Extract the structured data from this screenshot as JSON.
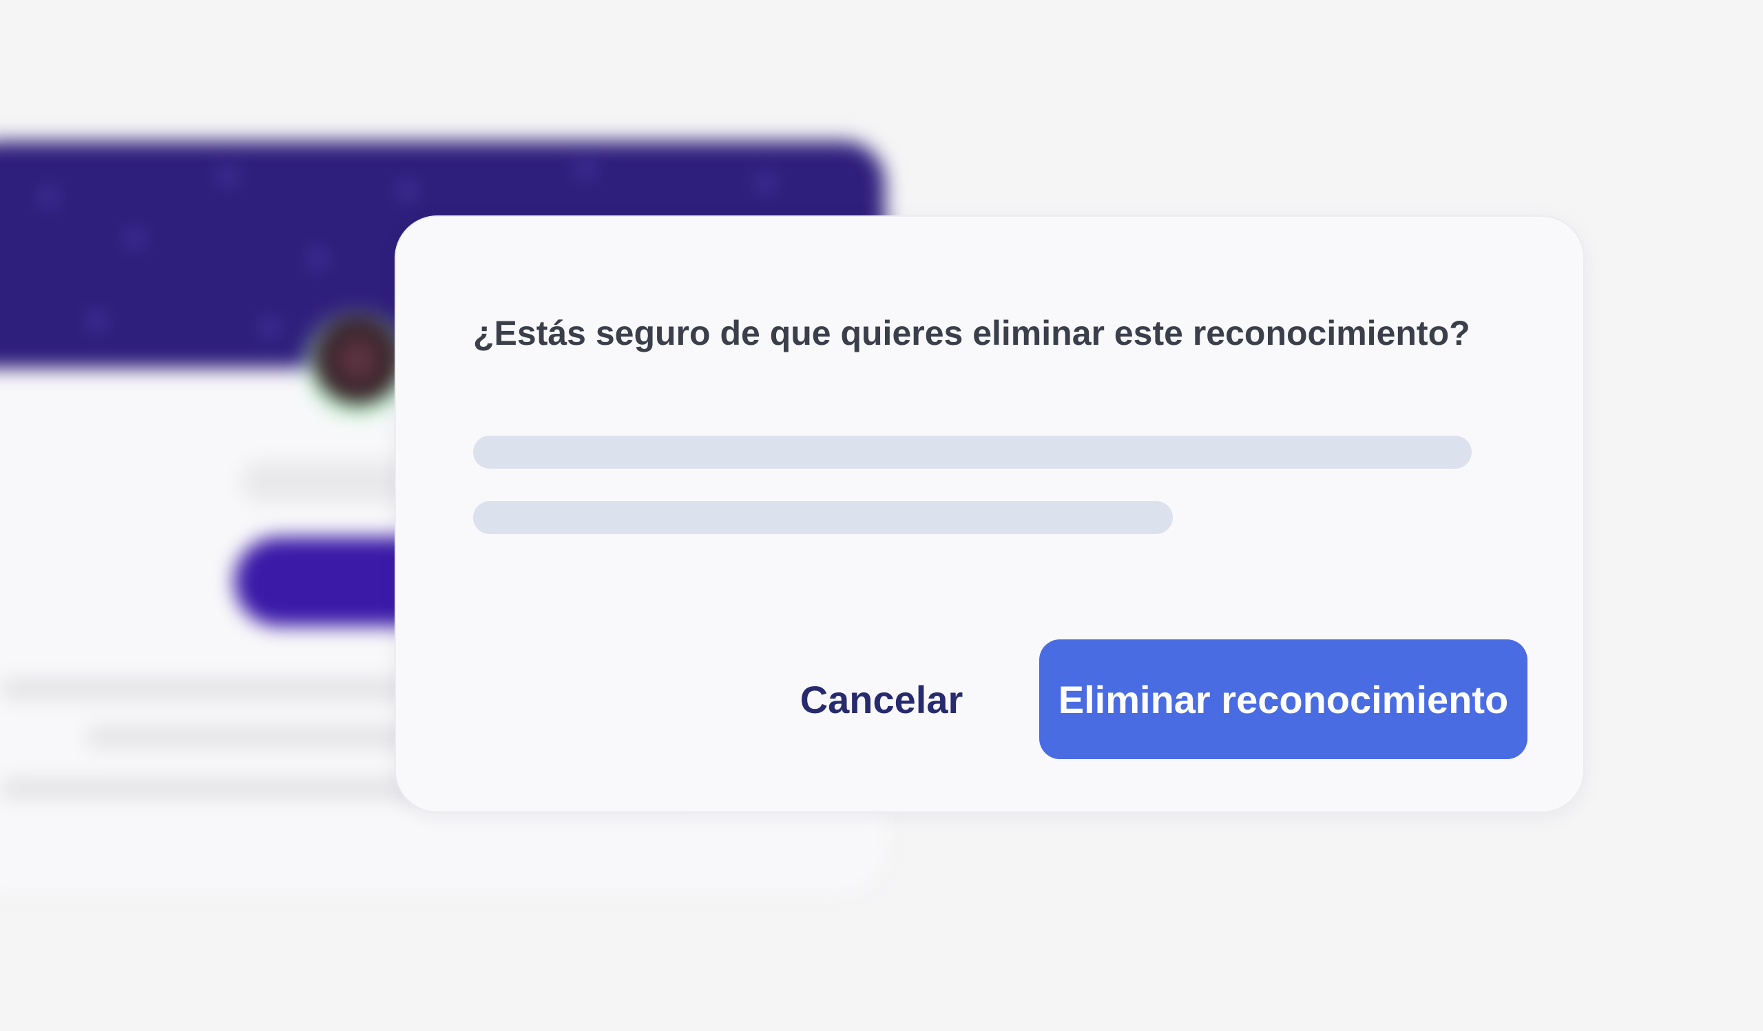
{
  "dialog": {
    "title": "¿Estás seguro de que quieres eliminar este reconocimiento?",
    "cancel_label": "Cancelar",
    "confirm_label": "Eliminar reconocimiento"
  },
  "colors": {
    "page_background": "#f5f5f6",
    "dialog_background": "#f9f9fc",
    "title_text": "#3a3f4a",
    "cancel_text": "#272a6e",
    "confirm_button": "#4a6ce3",
    "confirm_text": "#ffffff",
    "skeleton": "#dce1ee",
    "background_banner": "#2f1f7c",
    "background_button": "#3b1aa8"
  }
}
